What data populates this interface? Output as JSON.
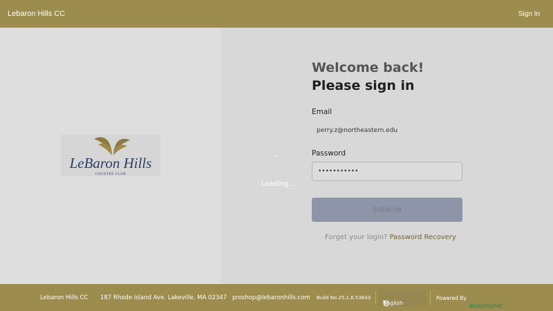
{
  "header": {
    "brand": "Lebaron Hills CC",
    "sign_in_link": "Sign In"
  },
  "branding": {
    "logo_text": "LeBaron Hills",
    "logo_subtext": "COUNTRY CLUB"
  },
  "loading_text": "Loading...",
  "form": {
    "welcome": "Welcome back!",
    "prompt": "Please sign in",
    "email_label": "Email",
    "email_value": "perry.z@northeastern.edu",
    "password_label": "Password",
    "password_value": "•••••••••••",
    "submit_label": "SIGN IN",
    "forgot_text": "Forget your login?",
    "recovery_link": "Password Recovery"
  },
  "footer": {
    "club_name": "Lebaron Hills CC",
    "address": "187 Rhode Island Ave. Lakeville, MA 02347",
    "email": "proshop@lebaronhills.com",
    "build": "Build No.25.1.6.53643",
    "language": "English",
    "powered_by": "Powered By",
    "provider_logo": "clubprophet"
  },
  "colors": {
    "accent": "#9c8c4e",
    "button": "#8f95a8"
  }
}
